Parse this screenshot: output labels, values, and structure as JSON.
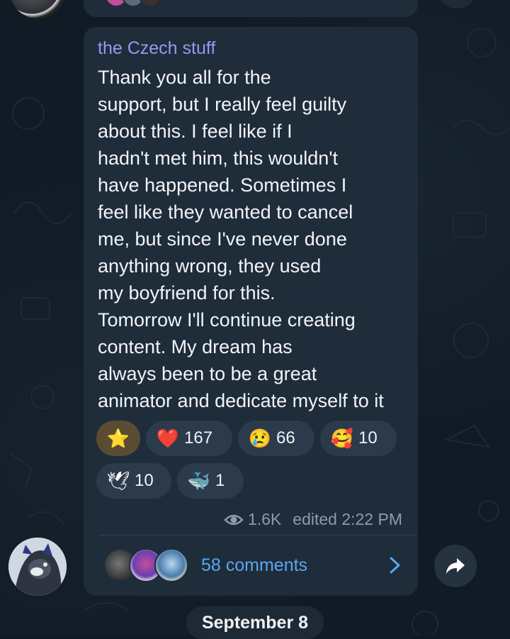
{
  "channel": {
    "name": "the Czech stuff"
  },
  "message": {
    "lines": [
      "Thank you all for the",
      "support, but I really feel guilty",
      "about this. I feel like if I",
      "hadn't met him, this wouldn't",
      "have happened. Sometimes I",
      "feel like they wanted to cancel",
      "me, but since I've never done",
      "anything wrong, they used",
      "my boyfriend for this.",
      "Tomorrow I'll continue creating",
      "content. My dream has",
      "always been to be a great",
      "animator and dedicate myself to it"
    ]
  },
  "reactions": [
    {
      "emoji": "⭐",
      "icon": "star-icon",
      "count": ""
    },
    {
      "emoji": "❤️",
      "icon": "heart-icon",
      "count": "167"
    },
    {
      "emoji": "😢",
      "icon": "crying-face-icon",
      "count": "66"
    },
    {
      "emoji": "🥰",
      "icon": "smiling-face-with-hearts-icon",
      "count": "10"
    },
    {
      "emoji": "🕊",
      "icon": "dove-icon",
      "count": "10"
    },
    {
      "emoji": "🐳",
      "icon": "whale-icon",
      "count": "1"
    }
  ],
  "meta": {
    "views": "1.6K",
    "edited": "edited 2:22 PM"
  },
  "comments": {
    "label": "58 comments"
  },
  "date_separator": "September 8",
  "colors": {
    "background": "#111b25",
    "bubble": "#1f2c3a",
    "channel_name": "#8d9ef0",
    "link": "#5aa7f2",
    "reaction_chip": "#2c3b4b",
    "reaction_chip_active": "#5a4c32"
  }
}
